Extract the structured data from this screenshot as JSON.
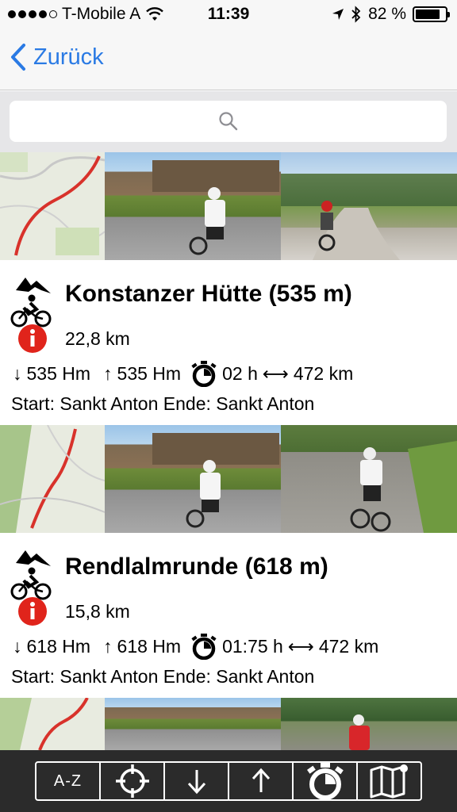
{
  "statusbar": {
    "carrier": "T-Mobile A",
    "time": "11:39",
    "battery_text": "82 %",
    "battery_level": 0.82
  },
  "nav": {
    "back_label": "Zurück"
  },
  "search": {
    "placeholder": ""
  },
  "tours": [
    {
      "title": "Konstanzer Hütte (535 m)",
      "distance": "22,8 km",
      "descent": "535 Hm",
      "ascent": "535 Hm",
      "duration": "02 h",
      "length": "472 km",
      "start_end": "Start: Sankt Anton Ende: Sankt Anton"
    },
    {
      "title": "Rendlalmrunde (618 m)",
      "distance": "15,8 km",
      "descent": "618 Hm",
      "ascent": "618 Hm",
      "duration": "01:75 h",
      "length": "472 km",
      "start_end": "Start: Sankt Anton Ende: Sankt Anton"
    }
  ],
  "toolbar": {
    "sort_az_label": "A-Z",
    "icons": [
      "crosshair-icon",
      "arrow-down-icon",
      "arrow-up-icon",
      "stopwatch-icon",
      "map-icon"
    ]
  },
  "colors": {
    "accent": "#2a7ae4",
    "info_red": "#e0241b",
    "toolbar_bg": "#2b2b2b"
  }
}
